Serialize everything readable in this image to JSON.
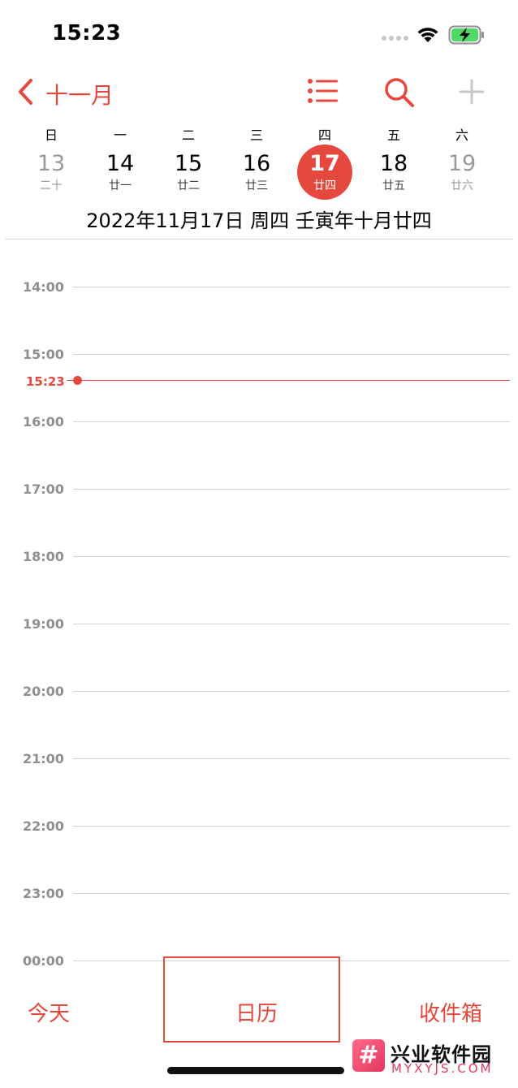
{
  "status_bar": {
    "time": "15:23"
  },
  "nav": {
    "back_label": "十一月"
  },
  "week": {
    "weekday_labels": [
      "日",
      "一",
      "二",
      "三",
      "四",
      "五",
      "六"
    ],
    "days": [
      {
        "num": "13",
        "lunar": "二十"
      },
      {
        "num": "14",
        "lunar": "廿一"
      },
      {
        "num": "15",
        "lunar": "廿二"
      },
      {
        "num": "16",
        "lunar": "廿三"
      },
      {
        "num": "17",
        "lunar": "廿四"
      },
      {
        "num": "18",
        "lunar": "廿五"
      },
      {
        "num": "19",
        "lunar": "廿六"
      }
    ],
    "selected_index": 4
  },
  "full_date": "2022年11月17日 周四   壬寅年十月廿四",
  "timeline": {
    "hours": [
      "14:00",
      "15:00",
      "16:00",
      "17:00",
      "18:00",
      "19:00",
      "20:00",
      "21:00",
      "22:00",
      "23:00",
      "00:00"
    ],
    "now_label": "15:23"
  },
  "tabs": {
    "today": "今天",
    "calendar": "日历",
    "inbox": "收件箱"
  },
  "watermark": {
    "logo": "#",
    "title": "兴业软件园",
    "subtitle": "MYXYJS.COM"
  },
  "colors": {
    "accent": "#e5493e",
    "battery": "#4cd964"
  }
}
